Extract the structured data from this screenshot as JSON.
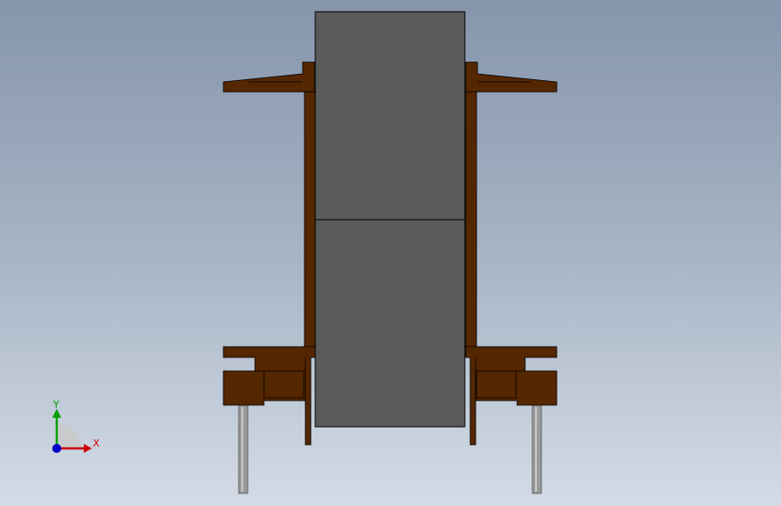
{
  "viewport": {
    "background_top": "#8595ab",
    "background_bottom": "#d4dbe6"
  },
  "model": {
    "bobbin_color": "#552700",
    "core_color": "#5a5a5a",
    "pin_color": "#9a9a9a",
    "outline_color": "#000000"
  },
  "triad": {
    "x_label": "X",
    "y_label": "Y",
    "x_color": "#cc0000",
    "y_color": "#00a000",
    "z_color": "#0000cc"
  }
}
